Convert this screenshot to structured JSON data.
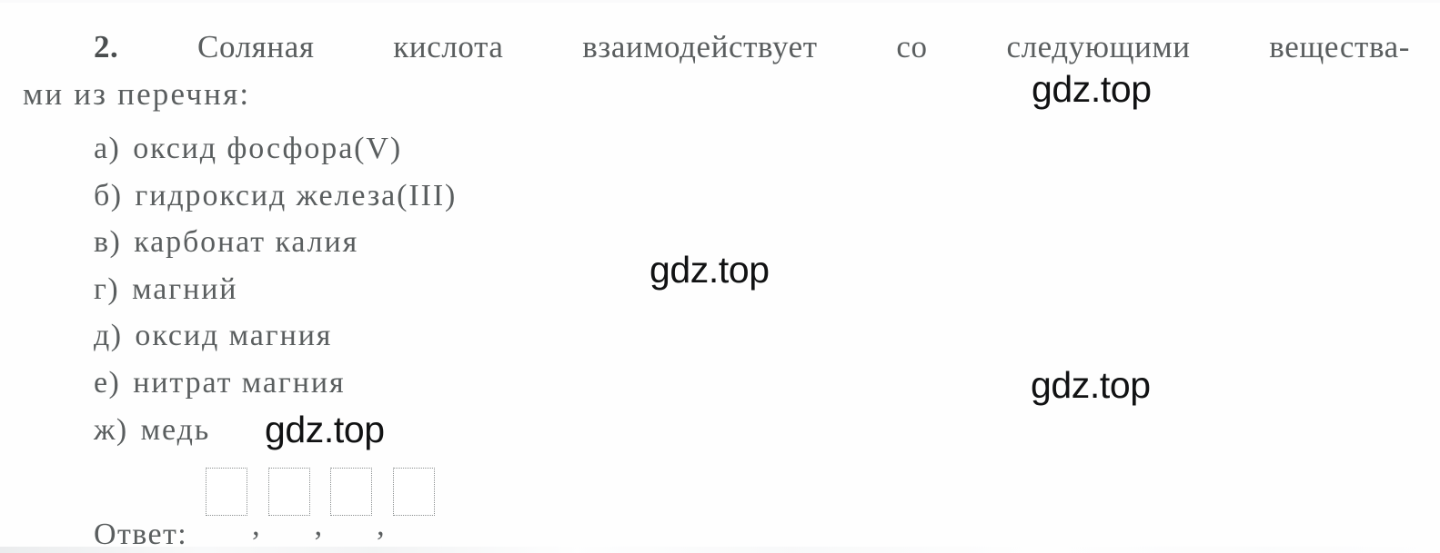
{
  "question": {
    "number": "2.",
    "line1_words": [
      "Соляная",
      "кислота",
      "взаимодействует",
      "со",
      "следующими",
      "вещества-"
    ],
    "line1_full": "2. Соляная кислота взаимодействует со следующими вещества-",
    "line2": "ми из перечня:"
  },
  "options": [
    {
      "marker": "а)",
      "text": "оксид фосфора(V)"
    },
    {
      "marker": "б)",
      "text": "гидроксид железа(III)"
    },
    {
      "marker": "в)",
      "text": "карбонат калия"
    },
    {
      "marker": "г)",
      "text": "магний"
    },
    {
      "marker": "д)",
      "text": "оксид магния"
    },
    {
      "marker": "е)",
      "text": "нитрат магния"
    },
    {
      "marker": "ж)",
      "text": "медь"
    }
  ],
  "answer": {
    "label": "Ответ:",
    "separator": ",",
    "boxes": [
      "",
      "",
      "",
      ""
    ]
  },
  "watermarks": [
    {
      "text": "gdz.top"
    },
    {
      "text": "gdz.top"
    },
    {
      "text": "gdz.top"
    },
    {
      "text": "gdz.top"
    }
  ],
  "colors": {
    "text": "#5a5e5f",
    "bold_text": "#4a4e4f",
    "box_border": "#8b8f90",
    "watermark": "#111213",
    "background": "#fefefe"
  }
}
